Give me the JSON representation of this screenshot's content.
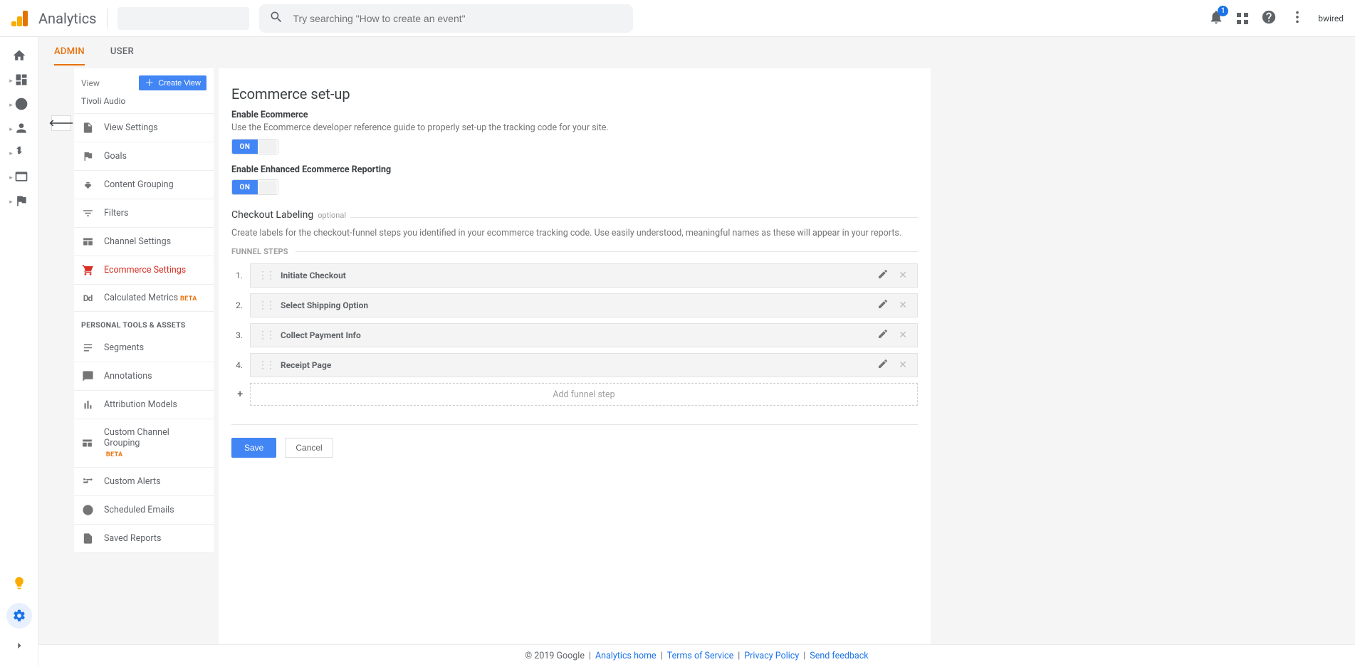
{
  "header": {
    "title": "Analytics",
    "search_placeholder": "Try searching \"How to create an event\"",
    "notification_count": "1",
    "user": "bwired"
  },
  "tabs": {
    "admin": "ADMIN",
    "user": "USER"
  },
  "view_column": {
    "label": "View",
    "create_label": "Create View",
    "view_name": "Tivoli Audio",
    "items": [
      "View Settings",
      "Goals",
      "Content Grouping",
      "Filters",
      "Channel Settings",
      "Ecommerce Settings",
      "Calculated Metrics"
    ],
    "beta": "BETA",
    "personal_header": "PERSONAL TOOLS & ASSETS",
    "personal_items": [
      "Segments",
      "Annotations",
      "Attribution Models",
      "Custom Channel Grouping",
      "Custom Alerts",
      "Scheduled Emails",
      "Saved Reports"
    ]
  },
  "page": {
    "title": "Ecommerce set-up",
    "enable_label": "Enable Ecommerce",
    "enable_help": "Use the Ecommerce developer reference guide to properly set-up the tracking code for your site.",
    "enhanced_label": "Enable Enhanced Ecommerce Reporting",
    "on": "ON",
    "checkout_label": "Checkout Labeling",
    "optional": "optional",
    "checkout_help": "Create labels for the checkout-funnel steps you identified in your ecommerce tracking code. Use easily understood, meaningful names as these will appear in your reports.",
    "funnel_label": "FUNNEL STEPS",
    "steps": [
      "Initiate Checkout",
      "Select Shipping Option",
      "Collect Payment Info",
      "Receipt Page"
    ],
    "add_step": "Add funnel step",
    "save": "Save",
    "cancel": "Cancel"
  },
  "footer": {
    "copyright": "© 2019 Google",
    "links": [
      "Analytics home",
      "Terms of Service",
      "Privacy Policy",
      "Send feedback"
    ]
  }
}
